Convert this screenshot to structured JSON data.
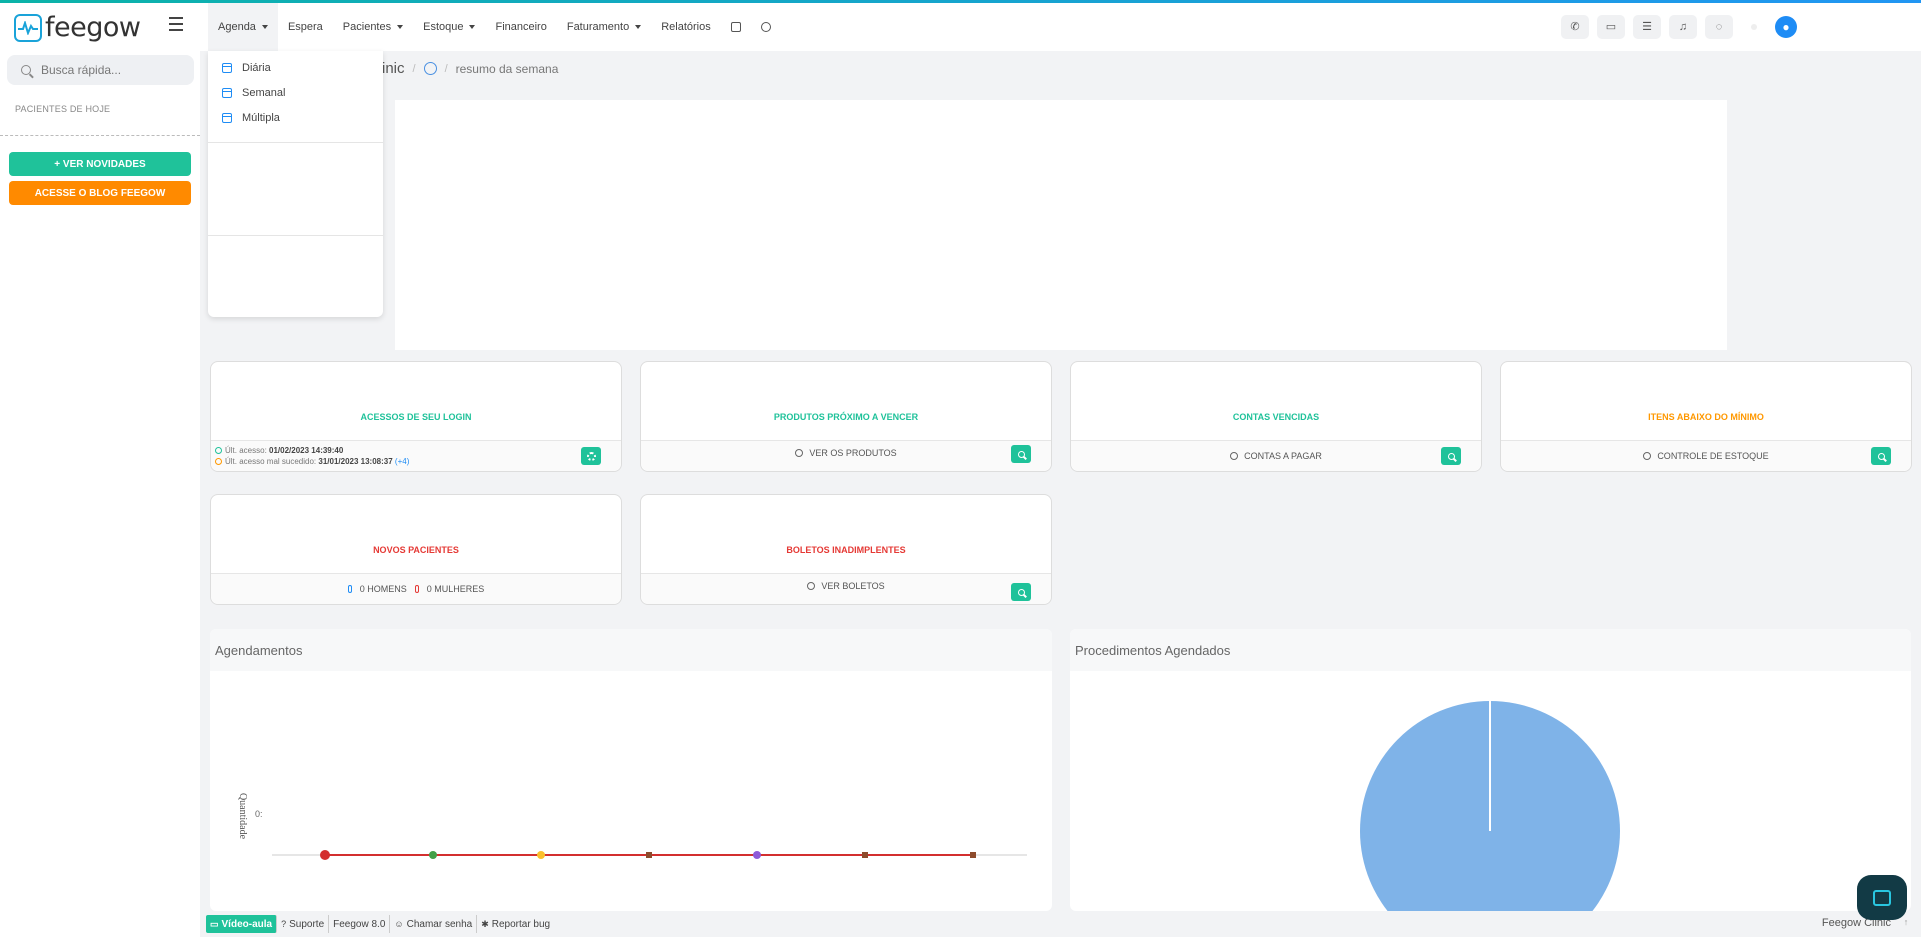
{
  "app": {
    "logo_text": "feegow"
  },
  "nav": {
    "items": [
      {
        "label": "Agenda",
        "caret": true
      },
      {
        "label": "Espera",
        "caret": false
      },
      {
        "label": "Pacientes",
        "caret": true
      },
      {
        "label": "Estoque",
        "caret": true
      },
      {
        "label": "Financeiro",
        "caret": false
      },
      {
        "label": "Faturamento",
        "caret": true
      },
      {
        "label": "Relatórios",
        "caret": false
      }
    ],
    "icons": [
      "database-icon",
      "gear-icon"
    ]
  },
  "topright": {
    "icons": [
      "phone-icon",
      "inbox-icon",
      "checklist-icon",
      "bell-icon",
      "chat-icon"
    ],
    "avatar_icon": "user-icon"
  },
  "sidebar": {
    "search_placeholder": "Busca rápida...",
    "pacientes_hoje": "PACIENTES DE HOJE",
    "btn_novidades": "+ VER NOVIDADES",
    "btn_blog": "ACESSE O BLOG FEEGOW"
  },
  "dropdown": {
    "items": [
      "Diária",
      "Semanal",
      "Múltipla"
    ]
  },
  "breadcrumb": {
    "clinic": "inic",
    "current": "resumo da semana"
  },
  "cards": {
    "acessos": {
      "title": "ACESSOS DE SEU LOGIN",
      "color": "#1fc29a",
      "ult_acesso_label": "Últ. acesso:",
      "ult_acesso_value": "01/02/2023 14:39:40",
      "mal_sucedido_label": "Últ. acesso mal sucedido:",
      "mal_sucedido_value": "31/01/2023 13:08:37",
      "mal_sucedido_extra": "(+4)"
    },
    "produtos": {
      "title": "PRODUTOS PRÓXIMO A VENCER",
      "color": "#1fc29a",
      "foot": "VER OS PRODUTOS"
    },
    "contas": {
      "title": "CONTAS VENCIDAS",
      "color": "#1fc29a",
      "foot": "CONTAS A PAGAR"
    },
    "itens": {
      "title": "ITENS ABAIXO DO MÍNIMO",
      "color": "#ff9800",
      "foot": "CONTROLE DE ESTOQUE"
    },
    "novos": {
      "title": "NOVOS PACIENTES",
      "color": "#e53935",
      "homens": "0 HOMENS",
      "mulheres": "0 MULHERES"
    },
    "boletos": {
      "title": "BOLETOS INADIMPLENTES",
      "color": "#e53935",
      "foot": "VER BOLETOS"
    }
  },
  "panels": {
    "agendamentos": "Agendamentos",
    "procedimentos": "Procedimentos Agendados"
  },
  "chart_data": [
    {
      "type": "line",
      "title": "Agendamentos",
      "ylabel": "Quantidade",
      "yticks": [
        "0:"
      ],
      "x": [
        1,
        2,
        3,
        4,
        5,
        6,
        7
      ],
      "series": [
        {
          "values": [
            0,
            0,
            0,
            0,
            0,
            0,
            0
          ],
          "color": "#d32f2f"
        }
      ],
      "marker_colors": [
        "#d32f2f",
        "#43a047",
        "#fbc02d",
        "#8d4b2c",
        "#8e5ad8",
        "#8d4b2c",
        "#8d4b2c"
      ]
    },
    {
      "type": "pie",
      "title": "Procedimentos Agendados",
      "values": [
        100
      ],
      "color": "#7fb3e8"
    }
  ],
  "footer": {
    "video": "Vídeo-aula",
    "suporte": "Suporte",
    "versao": "Feegow 8.0",
    "chamar": "Chamar senha",
    "bug": "Reportar bug",
    "right": "Feegow Clinic"
  }
}
